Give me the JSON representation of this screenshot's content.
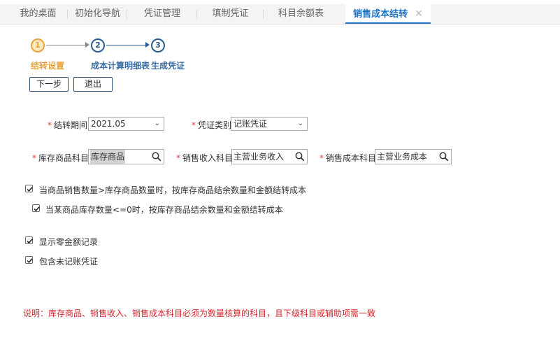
{
  "tabs": [
    {
      "label": "我的桌面"
    },
    {
      "label": "初始化导航"
    },
    {
      "label": "凭证管理"
    },
    {
      "label": "填制凭证"
    },
    {
      "label": "科目余额表"
    },
    {
      "label": "销售成本结转",
      "close": "✕"
    }
  ],
  "steps": [
    {
      "number": "1",
      "label": "结转设置"
    },
    {
      "number": "2",
      "label": "成本计算明细表"
    },
    {
      "number": "3",
      "label": "生成凭证"
    }
  ],
  "buttons": {
    "next": "下一步",
    "exit": "退出"
  },
  "form": {
    "period": {
      "required": "*",
      "label": "结转期间",
      "value": "2021.05"
    },
    "voucher_type": {
      "required": "*",
      "label": "凭证类别",
      "value": "记账凭证"
    },
    "inventory_account": {
      "required": "*",
      "label": "库存商品科目",
      "value": "库存商品"
    },
    "sales_revenue_account": {
      "required": "*",
      "label": "销售收入科目",
      "value": "主营业务收入"
    },
    "sales_cost_account": {
      "required": "*",
      "label": "销售成本科目",
      "value": "主营业务成本"
    }
  },
  "options": [
    {
      "label": "当商品销售数量>库存商品数量时，按库存商品结余数量和金额结转成本",
      "checked": true
    },
    {
      "label": "当某商品库存数量<=0时，按库存商品结余数量和金额结转成本",
      "checked": true
    },
    {
      "label": "显示零金额记录",
      "checked": true
    },
    {
      "label": "包含未记账凭证",
      "checked": true
    }
  ],
  "note": "说明：库存商品、销售收入、销售成本科目必须为数量核算的科目，且下级科目或辅助项需一致",
  "colors": {
    "accent": "#1d74c5",
    "active_step": "#e8a33c",
    "required": "#e23b3b",
    "note": "#d9262c"
  }
}
